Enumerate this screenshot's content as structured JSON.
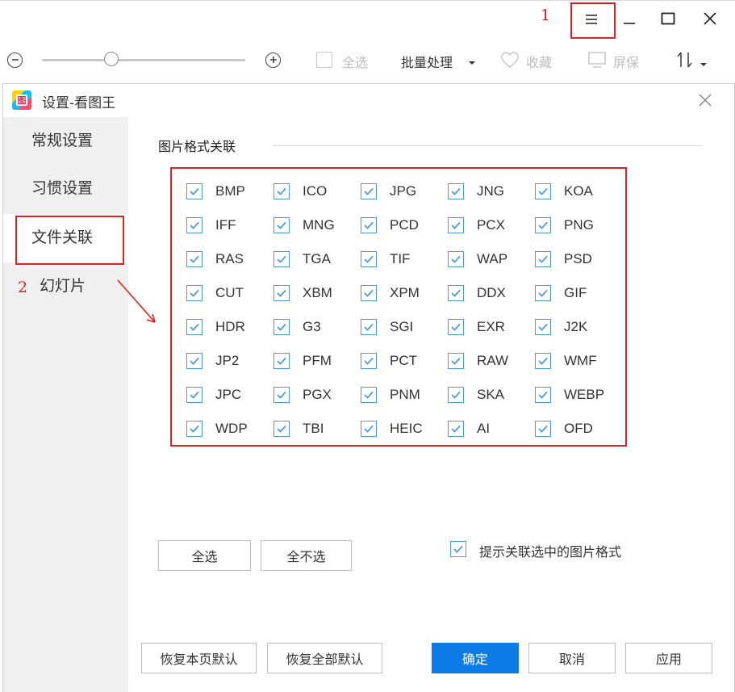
{
  "annotations": {
    "step1": "1",
    "step2": "2"
  },
  "toolbar": {
    "zoom_out_symbol": "⊖",
    "zoom_in_symbol": "⊕",
    "zoom_level": 0.35,
    "select_all": "全选",
    "batch": "批量处理",
    "favorite": "收藏",
    "screensaver": "屏保"
  },
  "dialog": {
    "title": "设置-看图王",
    "close_icon": "close-icon"
  },
  "sidebar": {
    "items": [
      {
        "label": "常规设置"
      },
      {
        "label": "习惯设置"
      },
      {
        "label": "文件关联"
      },
      {
        "label": "幻灯片"
      }
    ],
    "active_index": 2
  },
  "section": {
    "title": "图片格式关联"
  },
  "formats": [
    [
      "BMP",
      "ICO",
      "JPG",
      "JNG",
      "KOA"
    ],
    [
      "IFF",
      "MNG",
      "PCD",
      "PCX",
      "PNG"
    ],
    [
      "RAS",
      "TGA",
      "TIF",
      "WAP",
      "PSD"
    ],
    [
      "CUT",
      "XBM",
      "XPM",
      "DDX",
      "GIF"
    ],
    [
      "HDR",
      "G3",
      "SGI",
      "EXR",
      "J2K"
    ],
    [
      "JP2",
      "PFM",
      "PCT",
      "RAW",
      "WMF"
    ],
    [
      "JPC",
      "PGX",
      "PNM",
      "SKA",
      "WEBP"
    ],
    [
      "WDP",
      "TBI",
      "HEIC",
      "AI",
      "OFD"
    ]
  ],
  "formats_checked": true,
  "buttons": {
    "select_all": "全选",
    "select_none": "全不选",
    "prompt_label": "提示关联选中的图片格式",
    "restore_page": "恢复本页默认",
    "restore_all": "恢复全部默认",
    "ok": "确定",
    "cancel": "取消",
    "apply": "应用"
  },
  "colors": {
    "accent": "#0c7be6",
    "checkbox": "#4c9ad6",
    "annotation": "#e32020"
  }
}
